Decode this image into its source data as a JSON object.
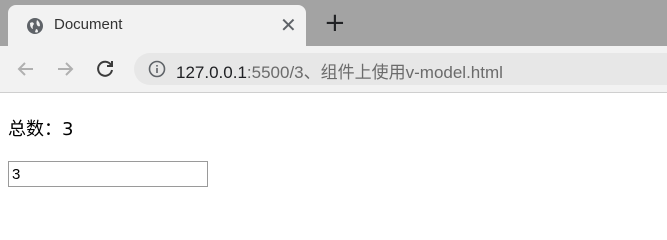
{
  "tab": {
    "title": "Document",
    "close_glyph": "✕",
    "favicon": "globe-icon",
    "new_tab_glyph": "+"
  },
  "toolbar": {
    "back_icon": "arrow-left-icon",
    "forward_icon": "arrow-right-icon",
    "reload_icon": "reload-icon",
    "info_icon": "info-icon",
    "url_host": "127.0.0.1",
    "url_path": ":5500/3、组件上使用v-model.html"
  },
  "page": {
    "total_label": "总数：3",
    "input_value": "3"
  },
  "colors": {
    "tabstrip": "#a3a3a3",
    "toolbar": "#f2f2f2",
    "omnibox": "#e7e7e7"
  }
}
